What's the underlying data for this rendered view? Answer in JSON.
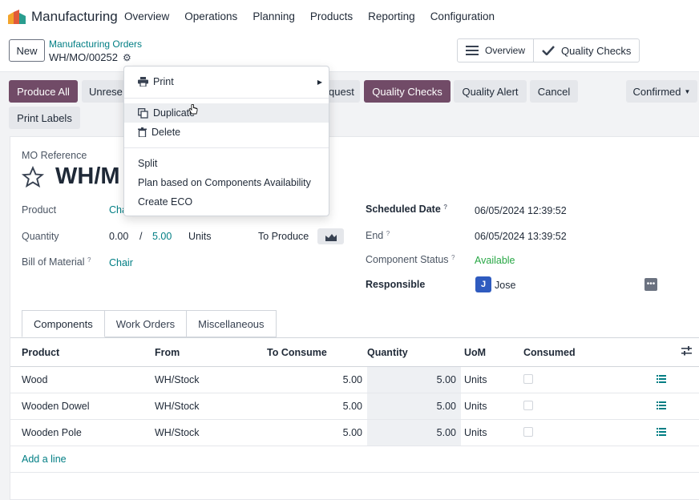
{
  "topbar": {
    "app_name": "Manufacturing",
    "menu": [
      "Overview",
      "Operations",
      "Planning",
      "Products",
      "Reporting",
      "Configuration"
    ]
  },
  "control": {
    "new_label": "New",
    "breadcrumb": "Manufacturing Orders",
    "record": "WH/MO/00252",
    "overview_label": "Overview",
    "quality_checks_label": "Quality Checks"
  },
  "actions": {
    "produce_all": "Produce All",
    "unreserve": "Unrese",
    "request": "quest",
    "quality_checks": "Quality Checks",
    "quality_alert": "Quality Alert",
    "cancel": "Cancel",
    "status": "Confirmed",
    "print_labels": "Print Labels"
  },
  "menu_dropdown": {
    "print": "Print",
    "duplicate": "Duplicate",
    "delete": "Delete",
    "split": "Split",
    "plan": "Plan based on Components Availability",
    "create_eco": "Create ECO"
  },
  "form": {
    "mo_reference_label": "MO Reference",
    "mo_reference_partial": "WH/M",
    "product_label": "Product",
    "product_value_partial": "Cha",
    "quantity_label": "Quantity",
    "quantity_done": "0.00",
    "quantity_slash": "/",
    "quantity_target": "5.00",
    "quantity_uom": "Units",
    "to_produce_label": "To Produce",
    "bom_label": "Bill of Material",
    "bom_value": "Chair",
    "scheduled_label": "Scheduled Date",
    "scheduled_value": "06/05/2024 12:39:52",
    "end_label": "End",
    "end_value": "06/05/2024 13:39:52",
    "component_status_label": "Component Status",
    "component_status_value": "Available",
    "responsible_label": "Responsible",
    "responsible_initial": "J",
    "responsible_value": "Jose",
    "help_mark": "?"
  },
  "tabs": [
    "Components",
    "Work Orders",
    "Miscellaneous"
  ],
  "table": {
    "headers": {
      "product": "Product",
      "from": "From",
      "to_consume": "To Consume",
      "quantity": "Quantity",
      "uom": "UoM",
      "consumed": "Consumed"
    },
    "rows": [
      {
        "product": "Wood",
        "from": "WH/Stock",
        "to_consume": "5.00",
        "quantity": "5.00",
        "uom": "Units"
      },
      {
        "product": "Wooden Dowel",
        "from": "WH/Stock",
        "to_consume": "5.00",
        "quantity": "5.00",
        "uom": "Units"
      },
      {
        "product": "Wooden Pole",
        "from": "WH/Stock",
        "to_consume": "5.00",
        "quantity": "5.00",
        "uom": "Units"
      }
    ],
    "add_line": "Add a line"
  },
  "colors": {
    "primary": "#714b67",
    "link": "#017e84",
    "avatar": "#2f5bbf"
  }
}
